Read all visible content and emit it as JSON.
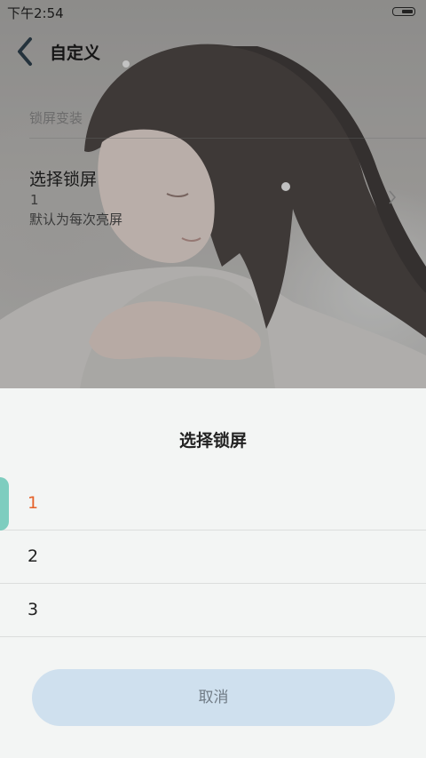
{
  "status_bar": {
    "time": "下午2:54"
  },
  "header": {
    "title": "自定义",
    "back_icon": "chevron-left-icon"
  },
  "settings": {
    "section_header": "锁屏变装",
    "preference": {
      "title": "选择锁屏",
      "value": "1",
      "summary": "默认为每次亮屏"
    }
  },
  "sheet": {
    "title": "选择锁屏",
    "options": [
      {
        "label": "1",
        "selected": true
      },
      {
        "label": "2",
        "selected": false
      },
      {
        "label": "3",
        "selected": false
      }
    ],
    "cancel_label": "取消"
  },
  "colors": {
    "accent_selected_text": "#e5622a",
    "selected_marker": "#7ecdbf",
    "cancel_button_bg": "#cfe0ee",
    "sheet_bg": "#f3f5f4"
  }
}
